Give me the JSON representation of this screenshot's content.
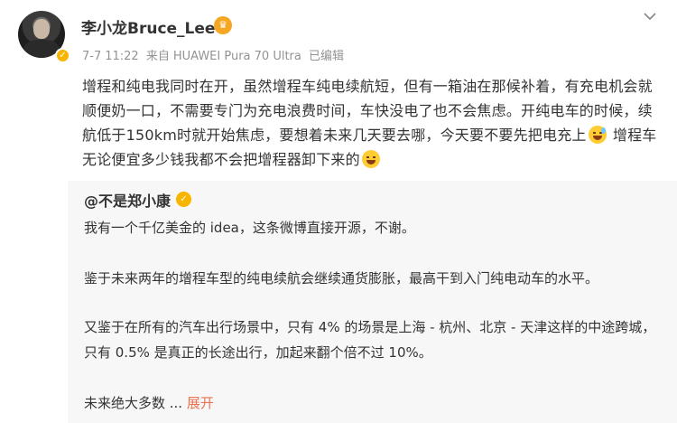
{
  "post": {
    "author": "李小龙Bruce_Lee",
    "meta": {
      "date": "7-7",
      "time": "11:22",
      "source_prefix": "来自",
      "device": "HUAWEI Pura 70 Ultra",
      "edited": "已编辑"
    },
    "text_part1": "增程和纯电我同时在开，虽然增程车纯电续航短，但有一箱油在那候补着，有充电机会就顺便奶一口，不需要专门为充电浪费时间，车快没电了也不会焦虑。开纯电车的时候，续航低于150km时就开始焦虑，要想着未来几天要去哪，今天要不要先把电充上",
    "emoji1": "sweat-smile-emoji",
    "text_part2": " 增程车无论便宜多少钱我都不会把增程器卸下来的",
    "emoji2": "grin-emoji"
  },
  "repost": {
    "author": "@不是郑小康",
    "paragraphs": [
      "我有一个千亿美金的 idea，这条微博直接开源，不谢。",
      "鉴于未来两年的增程车型的纯电续航会继续通货膨胀，最高干到入门纯电动车的水平。",
      "又鉴于在所有的汽车出行场景中，只有 4% 的场景是上海 - 杭州、北京 - 天津这样的中途跨城，只有 0.5% 是真正的长途出行，加起来翻个倍不过 10%。",
      "未来绝大多数 ..."
    ],
    "expand_label": "展开"
  },
  "icons": {
    "author_badge": "crown-icon",
    "verified": "verified-badge-icon",
    "menu": "chevron-down-icon"
  },
  "colors": {
    "link": "#eb7350",
    "meta": "#939393",
    "repost_bg": "#f7f7f7"
  }
}
